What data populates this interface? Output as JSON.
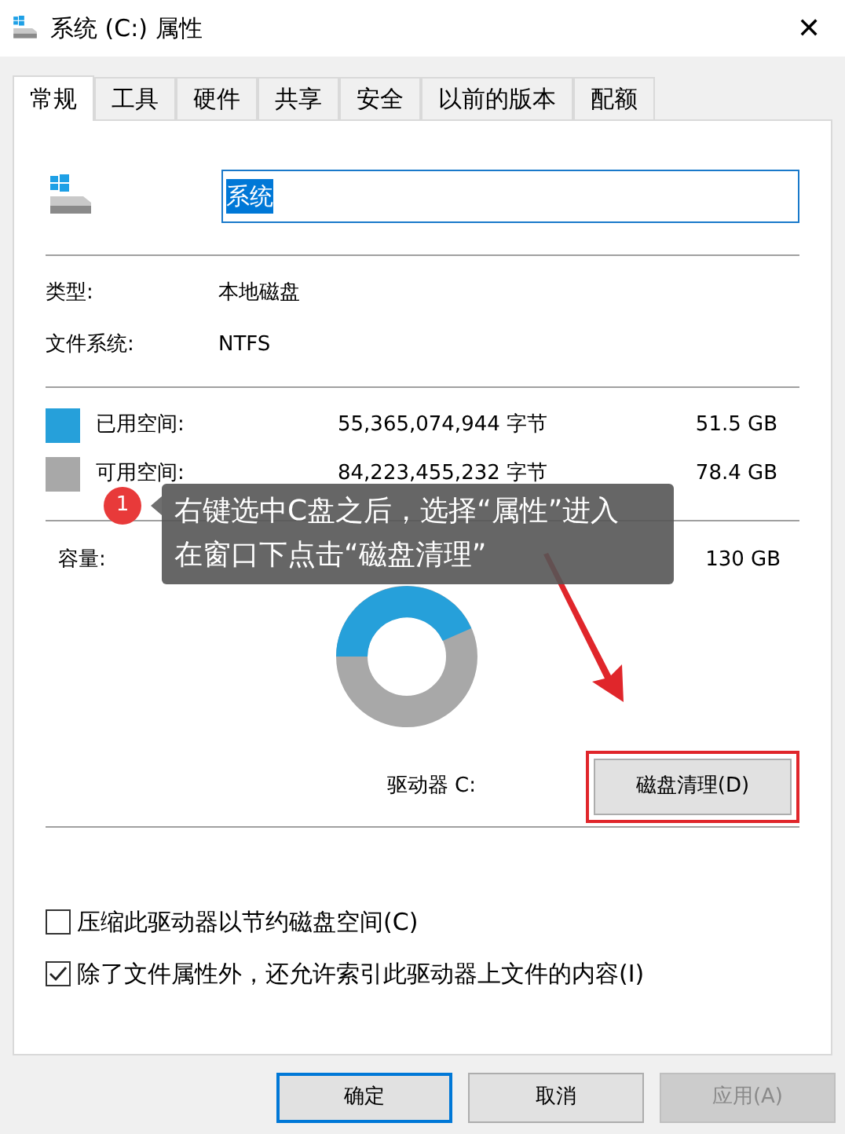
{
  "window": {
    "title": "系统 (C:) 属性",
    "close": "✕"
  },
  "tabs": [
    {
      "label": "常规",
      "selected": true
    },
    {
      "label": "工具",
      "selected": false
    },
    {
      "label": "硬件",
      "selected": false
    },
    {
      "label": "共享",
      "selected": false
    },
    {
      "label": "安全",
      "selected": false
    },
    {
      "label": "以前的版本",
      "selected": false
    },
    {
      "label": "配额",
      "selected": false
    }
  ],
  "name_field": {
    "value": "系统",
    "selected": true
  },
  "info": [
    {
      "label": "类型:",
      "value": "本地磁盘"
    },
    {
      "label": "文件系统:",
      "value": "NTFS"
    }
  ],
  "space": [
    {
      "label": "已用空间:",
      "bytes": "55,365,074,944 字节",
      "size": "51.5 GB",
      "color": "#26a0da"
    },
    {
      "label": "可用空间:",
      "bytes": "84,223,455,232 字节",
      "size": "78.4 GB",
      "color": "#a8a8a8"
    }
  ],
  "capacity": {
    "label": "容量:",
    "size": "130 GB"
  },
  "drive_label": "驱动器 C:",
  "cleanup_button": {
    "label": "磁盘清理(D)",
    "highlighted": true
  },
  "options": [
    {
      "label": "压缩此驱动器以节约磁盘空间(C)",
      "checked": false
    },
    {
      "label": "除了文件属性外，还允许索引此驱动器上文件的内容(I)",
      "checked": true
    }
  ],
  "buttons": [
    {
      "label": "确定",
      "default": true,
      "disabled": false
    },
    {
      "label": "取消",
      "default": false,
      "disabled": false
    },
    {
      "label": "应用(A)",
      "default": false,
      "disabled": true
    }
  ],
  "annotation": {
    "number": "1",
    "lines": [
      "右键选中C盘之后，选择“属性”进入",
      "在窗口下点击“磁盘清理”"
    ]
  }
}
